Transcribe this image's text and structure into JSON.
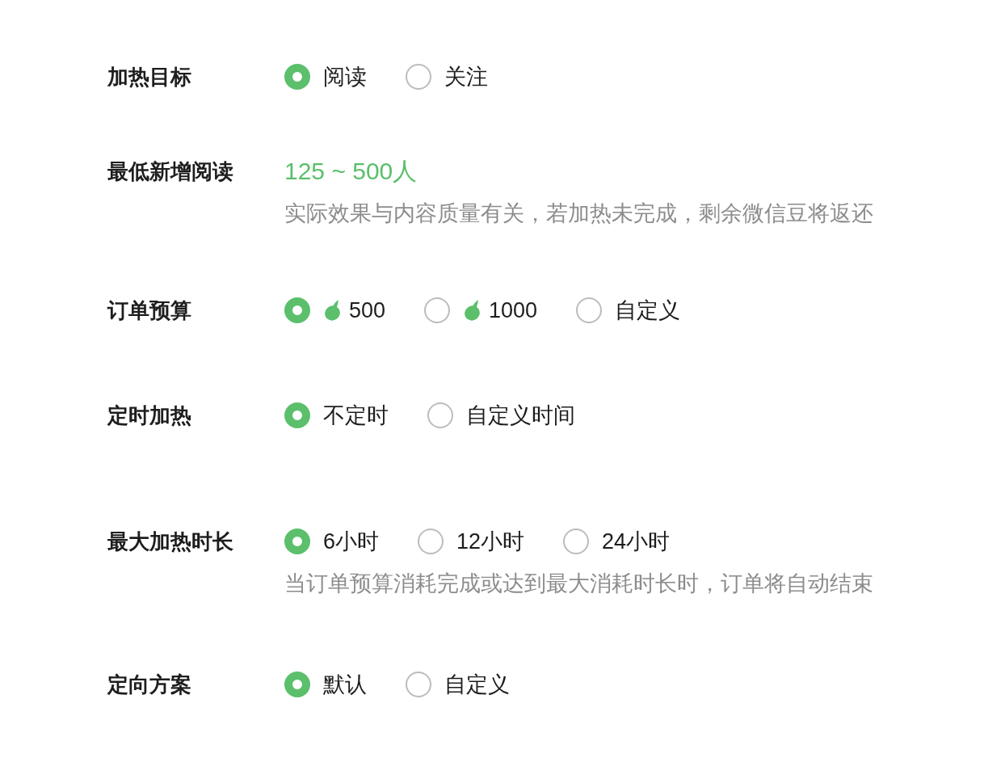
{
  "form": {
    "fields": [
      {
        "label": "加热目标",
        "kind": "radio",
        "options": [
          {
            "label": "阅读",
            "kind": "plain",
            "selected": true
          },
          {
            "label": "关注",
            "kind": "plain",
            "selected": false
          }
        ]
      },
      {
        "label": "最低新增阅读",
        "kind": "estimate",
        "value": "125 ~ 500人",
        "hint": "实际效果与内容质量有关，若加热未完成，剩余微信豆将返还"
      },
      {
        "label": "订单预算",
        "kind": "radio",
        "options": [
          {
            "label": "500",
            "kind": "bean_amount",
            "selected": true
          },
          {
            "label": "1000",
            "kind": "bean_amount",
            "selected": false
          },
          {
            "label": "自定义",
            "kind": "plain",
            "selected": false
          }
        ]
      },
      {
        "label": "定时加热",
        "kind": "radio",
        "options": [
          {
            "label": "不定时",
            "kind": "plain",
            "selected": true
          },
          {
            "label": "自定义时间",
            "kind": "plain",
            "selected": false
          }
        ]
      },
      {
        "label": "最大加热时长",
        "kind": "radio",
        "options": [
          {
            "label": "6小时",
            "kind": "plain",
            "selected": true
          },
          {
            "label": "12小时",
            "kind": "plain",
            "selected": false
          },
          {
            "label": "24小时",
            "kind": "plain",
            "selected": false
          }
        ],
        "hint": "当订单预算消耗完成或达到最大消耗时长时，订单将自动结束"
      },
      {
        "label": "定向方案",
        "kind": "radio",
        "options": [
          {
            "label": "默认",
            "kind": "plain",
            "selected": true
          },
          {
            "label": "自定义",
            "kind": "plain",
            "selected": false
          }
        ]
      }
    ]
  }
}
